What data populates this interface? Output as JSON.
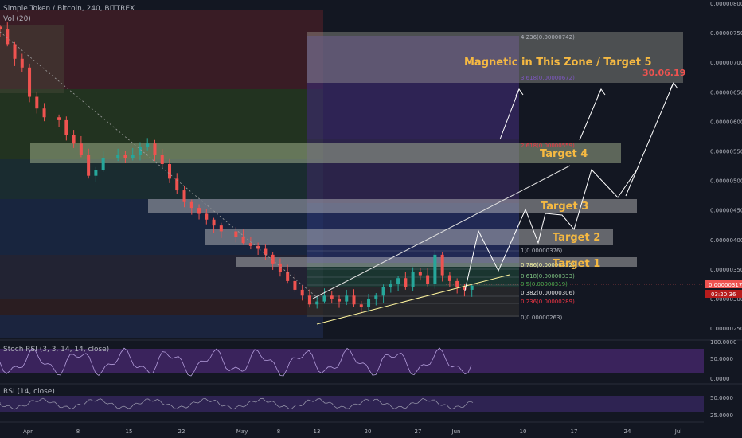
{
  "header": {
    "symbol_line": "Simple Token / Bitcoin, 240, BITTREX",
    "volume_label": "Vol (20)",
    "stoch_label": "Stoch RSI (3, 3, 14, 14, close)",
    "rsi_label": "RSI (14, close)"
  },
  "price_axis": {
    "ticks": [
      "0.00000800",
      "0.00000750",
      "0.00000700",
      "0.00000650",
      "0.00000600",
      "0.00000550",
      "0.00000500",
      "0.00000450",
      "0.00000400",
      "0.00000350",
      "0.00000300",
      "0.00000250"
    ],
    "current_price": "0.00000317",
    "countdown": "03:20:36",
    "current_color": "#ef5350"
  },
  "stoch_axis": {
    "ticks": [
      "100.0000",
      "50.0000",
      "0.0000"
    ]
  },
  "rsi_axis": {
    "ticks": [
      "50.0000",
      "25.0000"
    ]
  },
  "time_axis": {
    "ticks": [
      "Apr",
      "8",
      "15",
      "22",
      "May",
      "8",
      "13",
      "20",
      "27",
      "Jun",
      "10",
      "17",
      "24",
      "Jul"
    ]
  },
  "fib_upper": [
    {
      "label": "4.236(0.00000742)",
      "color": "#b2b5be"
    },
    {
      "label": "3.618(0.00000672)",
      "color": "#7e57c2"
    },
    {
      "label": "2.618(0.00000559)",
      "color": "#f23645"
    }
  ],
  "fib_lower": [
    {
      "label": "1(0.00000376)",
      "color": "#b2b5be"
    },
    {
      "label": "0.786(0.00000352)",
      "color": "#f5f5a0"
    },
    {
      "label": "0.618(0.00000333)",
      "color": "#81c784"
    },
    {
      "label": "0.5(0.00000319)",
      "color": "#4caf50"
    },
    {
      "label": "0.382(0.00000306)",
      "color": "#e0e0e0"
    },
    {
      "label": "0.236(0.00000289)",
      "color": "#f23645"
    },
    {
      "label": "0(0.00000263)",
      "color": "#b2b5be"
    }
  ],
  "annotations": {
    "target5": "Magnetic in This Zone / Target 5",
    "date": "30.06.19",
    "target4": "Target 4",
    "target3": "Target 3",
    "target2": "Target 2",
    "target1": "Target 1"
  },
  "colors": {
    "background": "#131722",
    "up": "#26a69a",
    "down": "#ef5350",
    "annotation": "#f5b942",
    "date": "#ef5350",
    "stoch_band": "#5b2d8c",
    "rsi_band": "#3a2a66"
  },
  "chart_data": {
    "type": "candlestick",
    "title": "Simple Token / Bitcoin, 240, BITTREX",
    "x_range": [
      "2019-03-31",
      "2019-07-01"
    ],
    "y_range": [
      2.3e-06,
      8e-06
    ],
    "series": [
      {
        "name": "price (approx. close path)",
        "points": [
          [
            "2019-03-31",
            7.55e-06
          ],
          [
            "2019-04-01",
            7.3e-06
          ],
          [
            "2019-04-02",
            7.05e-06
          ],
          [
            "2019-04-03",
            6.9e-06
          ],
          [
            "2019-04-04",
            6.4e-06
          ],
          [
            "2019-04-05",
            6.2e-06
          ],
          [
            "2019-04-06",
            6.05e-06
          ],
          [
            "2019-04-08",
            6e-06
          ],
          [
            "2019-04-09",
            5.75e-06
          ],
          [
            "2019-04-10",
            5.6e-06
          ],
          [
            "2019-04-11",
            5.4e-06
          ],
          [
            "2019-04-12",
            5.05e-06
          ],
          [
            "2019-04-13",
            5.15e-06
          ],
          [
            "2019-04-14",
            5.35e-06
          ],
          [
            "2019-04-16",
            5.4e-06
          ],
          [
            "2019-04-17",
            5.35e-06
          ],
          [
            "2019-04-18",
            5.4e-06
          ],
          [
            "2019-04-19",
            5.55e-06
          ],
          [
            "2019-04-20",
            5.6e-06
          ],
          [
            "2019-04-21",
            5.4e-06
          ],
          [
            "2019-04-22",
            5.25e-06
          ],
          [
            "2019-04-23",
            5e-06
          ],
          [
            "2019-04-24",
            4.8e-06
          ],
          [
            "2019-04-25",
            4.6e-06
          ],
          [
            "2019-04-26",
            4.5e-06
          ],
          [
            "2019-04-27",
            4.4e-06
          ],
          [
            "2019-04-28",
            4.3e-06
          ],
          [
            "2019-04-29",
            4.2e-06
          ],
          [
            "2019-04-30",
            4.1e-06
          ],
          [
            "2019-05-02",
            4e-06
          ],
          [
            "2019-05-03",
            3.9e-06
          ],
          [
            "2019-05-04",
            3.85e-06
          ],
          [
            "2019-05-05",
            3.8e-06
          ],
          [
            "2019-05-06",
            3.7e-06
          ],
          [
            "2019-05-07",
            3.55e-06
          ],
          [
            "2019-05-08",
            3.4e-06
          ],
          [
            "2019-05-09",
            3.25e-06
          ],
          [
            "2019-05-10",
            3.1e-06
          ],
          [
            "2019-05-11",
            3e-06
          ],
          [
            "2019-05-12",
            2.85e-06
          ],
          [
            "2019-05-13",
            2.9e-06
          ],
          [
            "2019-05-14",
            3e-06
          ],
          [
            "2019-05-15",
            2.95e-06
          ],
          [
            "2019-05-16",
            2.9e-06
          ],
          [
            "2019-05-17",
            3e-06
          ],
          [
            "2019-05-18",
            2.85e-06
          ],
          [
            "2019-05-19",
            2.8e-06
          ],
          [
            "2019-05-20",
            2.95e-06
          ],
          [
            "2019-05-21",
            3e-06
          ],
          [
            "2019-05-22",
            3.15e-06
          ],
          [
            "2019-05-23",
            3.2e-06
          ],
          [
            "2019-05-24",
            3.3e-06
          ],
          [
            "2019-05-25",
            3.15e-06
          ],
          [
            "2019-05-26",
            3.4e-06
          ],
          [
            "2019-05-27",
            3.35e-06
          ],
          [
            "2019-05-28",
            3.2e-06
          ],
          [
            "2019-05-29",
            3.7e-06
          ],
          [
            "2019-05-30",
            3.35e-06
          ],
          [
            "2019-05-31",
            3.25e-06
          ],
          [
            "2019-06-01",
            3.15e-06
          ],
          [
            "2019-06-02",
            3.1e-06
          ],
          [
            "2019-06-03",
            3.17e-06
          ]
        ]
      }
    ],
    "fib_retracement": [
      {
        "level": 0,
        "value": 2.63e-06
      },
      {
        "level": 0.236,
        "value": 2.89e-06
      },
      {
        "level": 0.382,
        "value": 3.06e-06
      },
      {
        "level": 0.5,
        "value": 3.19e-06
      },
      {
        "level": 0.618,
        "value": 3.33e-06
      },
      {
        "level": 0.786,
        "value": 3.52e-06
      },
      {
        "level": 1,
        "value": 3.76e-06
      },
      {
        "level": 2.618,
        "value": 5.59e-06
      },
      {
        "level": 3.618,
        "value": 6.72e-06
      },
      {
        "level": 4.236,
        "value": 7.42e-06
      }
    ],
    "target_zones": [
      {
        "name": "Target 1",
        "low": 3.5e-06,
        "high": 3.65e-06
      },
      {
        "name": "Target 2",
        "low": 3.85e-06,
        "high": 4.1e-06
      },
      {
        "name": "Target 3",
        "low": 4.43e-06,
        "high": 4.65e-06
      },
      {
        "name": "Target 4",
        "low": 5.3e-06,
        "high": 5.6e-06
      },
      {
        "name": "Target 5",
        "low": 6.65e-06,
        "high": 7.55e-06
      }
    ],
    "current_price": 3.17e-06,
    "grid": false,
    "panes": [
      "price",
      "Stoch RSI (3, 3, 14, 14, close)",
      "RSI (14, close)"
    ]
  }
}
